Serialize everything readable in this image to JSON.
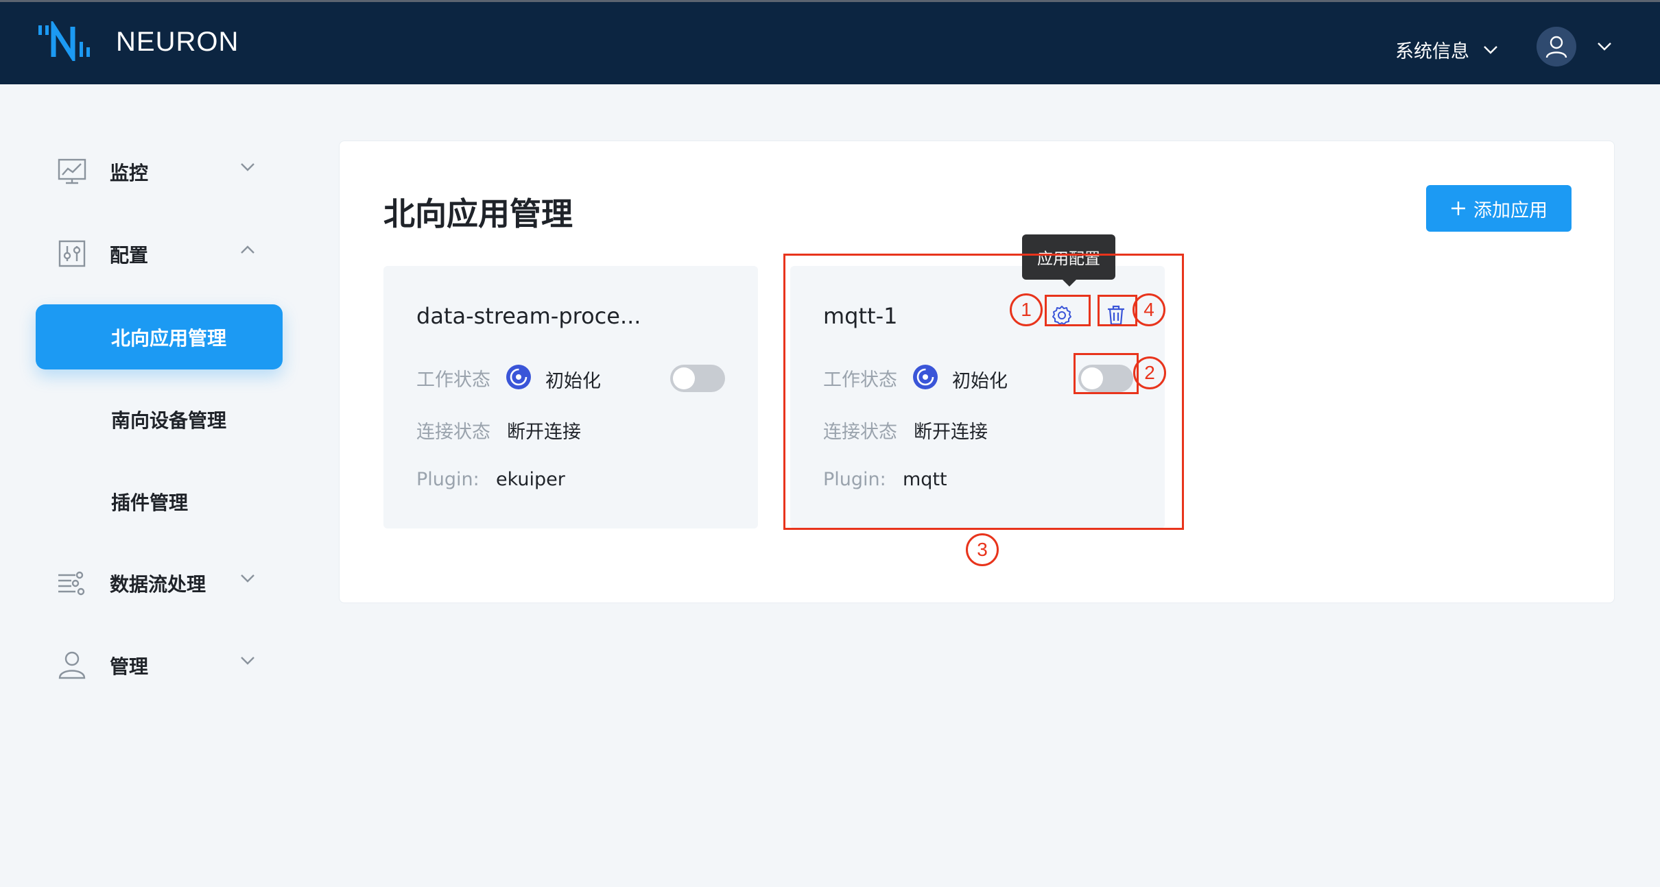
{
  "header": {
    "brand": "NEURON",
    "system_info": "系统信息"
  },
  "sidebar": {
    "items": [
      {
        "label": "监控",
        "icon": "monitor-chart-icon"
      },
      {
        "label": "配置",
        "icon": "sliders-icon"
      },
      {
        "label": "北向应用管理"
      },
      {
        "label": "南向设备管理"
      },
      {
        "label": "插件管理"
      },
      {
        "label": "数据流处理",
        "icon": "data-flow-icon"
      },
      {
        "label": "管理",
        "icon": "user-icon"
      }
    ],
    "active": "北向应用管理"
  },
  "main": {
    "title": "北向应用管理",
    "add_button": "添加应用",
    "labels": {
      "work_status": "工作状态",
      "connection_status": "连接状态",
      "plugin": "Plugin:"
    },
    "cards": [
      {
        "name": "data-stream-proce...",
        "work_status": "初始化",
        "connection_status": "断开连接",
        "plugin": "ekuiper",
        "enabled": false
      },
      {
        "name": "mqtt-1",
        "work_status": "初始化",
        "connection_status": "断开连接",
        "plugin": "mqtt",
        "enabled": false
      }
    ],
    "tooltip": "应用配置"
  },
  "annotations": [
    "1",
    "2",
    "3",
    "4"
  ],
  "colors": {
    "topbar": "#0c2541",
    "accent": "#1c9af3",
    "annotation": "#e8341c",
    "status_icon": "#3a55d8"
  }
}
